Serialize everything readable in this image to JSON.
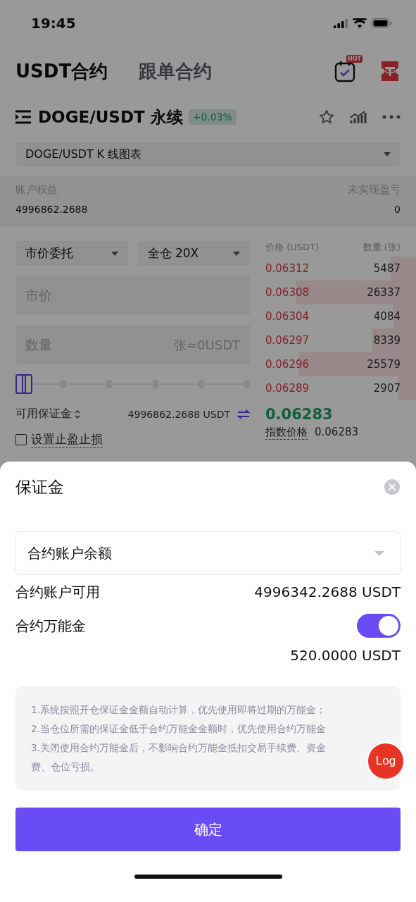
{
  "status_bar": {
    "time": "19:45"
  },
  "header": {
    "tabs": [
      {
        "label": "USDT合约",
        "selected": true
      },
      {
        "label": "跟单合约",
        "selected": false
      }
    ],
    "hot_badge": "HOT"
  },
  "pair": {
    "name": "DOGE/USDT 永续",
    "change": "+0.03%",
    "chart_select": "DOGE/USDT K 线图表"
  },
  "account": {
    "equity_label": "账户权益",
    "equity": "4996862.2688",
    "pnl_label": "未实现盈亏",
    "pnl": "0"
  },
  "order_form": {
    "order_type": "市价委托",
    "margin_mode": "全仓 20X",
    "price_placeholder": "市价",
    "qty_placeholder": "数量",
    "qty_unit": "张≈0USDT",
    "slider": {
      "level": 0
    },
    "available_label": "可用保证金",
    "available": "4996862.2688 USDT",
    "tpsl": {
      "label": "设置止盈止损",
      "checked": false
    }
  },
  "order_book": {
    "price_header": "价格 (USDT)",
    "qty_header": "数量 (张)",
    "asks": [
      {
        "price": "0.06312",
        "qty": "5487"
      },
      {
        "price": "0.06308",
        "qty": "26337"
      },
      {
        "price": "0.06304",
        "qty": "4084"
      },
      {
        "price": "0.06297",
        "qty": "8339"
      },
      {
        "price": "0.06296",
        "qty": "25579"
      },
      {
        "price": "0.06289",
        "qty": "2907"
      }
    ],
    "last_price": "0.06283",
    "index_label": "指数价格",
    "index_price": "0.06283"
  },
  "sheet": {
    "title": "保证金",
    "select": "合约账户余额",
    "available_label": "合约账户可用",
    "available": "4996342.2688 USDT",
    "bonus_label": "合约万能金",
    "bonus_on": true,
    "bonus_amount": "520.0000 USDT",
    "notes": [
      "1.系统按照开仓保证金金额自动计算，优先使用即将过期的万能金；",
      "2.当仓位所需的保证金低于合约万能金金额时，优先使用合约万能金",
      "3.关闭使用合约万能金后，不影响合约万能金抵扣交易手续费、资金",
      "费、仓位亏损。"
    ],
    "confirm": "确定"
  },
  "log_button": "Log"
}
